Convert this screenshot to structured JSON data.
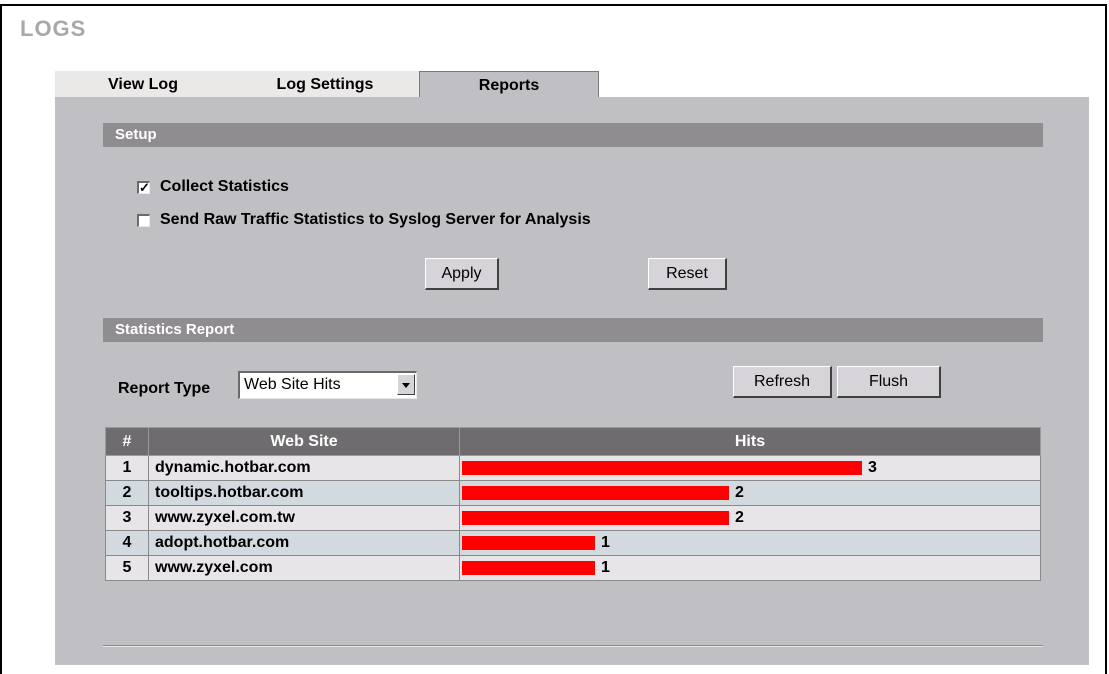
{
  "page": {
    "title": "LOGS"
  },
  "tabs": [
    {
      "label": "View Log",
      "active": false
    },
    {
      "label": "Log Settings",
      "active": false
    },
    {
      "label": "Reports",
      "active": true
    }
  ],
  "setup": {
    "heading": "Setup",
    "collect_statistics": {
      "label": "Collect Statistics",
      "checked": true
    },
    "send_raw": {
      "label": "Send Raw Traffic Statistics to Syslog Server for Analysis",
      "checked": false
    },
    "apply_label": "Apply",
    "reset_label": "Reset"
  },
  "statistics": {
    "heading": "Statistics Report",
    "report_type_label": "Report Type",
    "report_type_value": "Web Site Hits",
    "refresh_label": "Refresh",
    "flush_label": "Flush",
    "columns": [
      "#",
      "Web Site",
      "Hits"
    ],
    "max_hits": 3,
    "rows": [
      {
        "num": "1",
        "site": "dynamic.hotbar.com",
        "hits": 3
      },
      {
        "num": "2",
        "site": "tooltips.hotbar.com",
        "hits": 2
      },
      {
        "num": "3",
        "site": "www.zyxel.com.tw",
        "hits": 2
      },
      {
        "num": "4",
        "site": "adopt.hotbar.com",
        "hits": 1
      },
      {
        "num": "5",
        "site": "www.zyxel.com",
        "hits": 1
      }
    ]
  },
  "colors": {
    "bar": "#ff0000",
    "section_bar": "#8f8d8f",
    "panel": "#c0bfc4"
  }
}
